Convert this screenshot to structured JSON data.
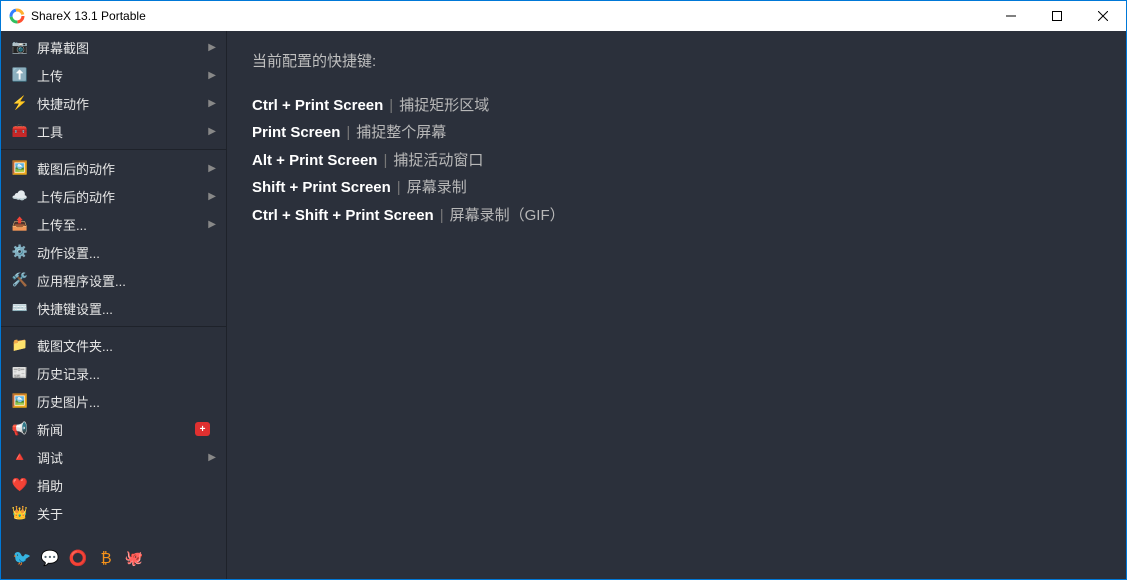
{
  "window": {
    "title": "ShareX 13.1 Portable"
  },
  "sidebar": {
    "groups": [
      [
        {
          "icon": "📷",
          "label": "屏幕截图",
          "submenu": true
        },
        {
          "icon": "⬆️",
          "icon_color": "#3ea6ff",
          "label": "上传",
          "submenu": true
        },
        {
          "icon": "⚡",
          "icon_color": "#ffd24d",
          "label": "快捷动作",
          "submenu": true
        },
        {
          "icon": "🧰",
          "icon_color": "#e05050",
          "label": "工具",
          "submenu": true
        }
      ],
      [
        {
          "icon": "🖼️",
          "label": "截图后的动作",
          "submenu": true
        },
        {
          "icon": "☁️",
          "label": "上传后的动作",
          "submenu": true
        },
        {
          "icon": "📤",
          "label": "上传至...",
          "submenu": true
        },
        {
          "icon": "⚙️",
          "label": "动作设置..."
        },
        {
          "icon": "🛠️",
          "label": "应用程序设置..."
        },
        {
          "icon": "⌨️",
          "label": "快捷键设置..."
        }
      ],
      [
        {
          "icon": "📁",
          "label": "截图文件夹..."
        },
        {
          "icon": "📰",
          "label": "历史记录..."
        },
        {
          "icon": "🖼️",
          "label": "历史图片..."
        },
        {
          "icon": "📢",
          "icon_color": "#e05050",
          "label": "新闻",
          "badge": "+"
        },
        {
          "icon": "🔺",
          "icon_color": "#e07040",
          "label": "调试",
          "submenu": true
        },
        {
          "icon": "❤️",
          "label": "捐助"
        },
        {
          "icon": "👑",
          "icon_color": "#f0c040",
          "label": "关于"
        }
      ]
    ],
    "social": [
      {
        "name": "twitter",
        "color": "#1da1f2",
        "glyph": "🐦"
      },
      {
        "name": "discord",
        "color": "#5865f2",
        "glyph": "💬"
      },
      {
        "name": "patreon",
        "color": "#ff424d",
        "glyph": "⭕"
      },
      {
        "name": "bitcoin",
        "color": "#f7931a",
        "glyph": "₿"
      },
      {
        "name": "github",
        "color": "#e6e6e6",
        "glyph": "🐙"
      }
    ]
  },
  "main": {
    "heading": "当前配置的快捷键:",
    "hotkeys": [
      {
        "key": "Ctrl + Print Screen",
        "desc": "捕捉矩形区域"
      },
      {
        "key": "Print Screen",
        "desc": "捕捉整个屏幕"
      },
      {
        "key": "Alt + Print Screen",
        "desc": "捕捉活动窗口"
      },
      {
        "key": "Shift + Print Screen",
        "desc": "屏幕录制"
      },
      {
        "key": "Ctrl + Shift + Print Screen",
        "desc": "屏幕录制（GIF）"
      }
    ]
  }
}
